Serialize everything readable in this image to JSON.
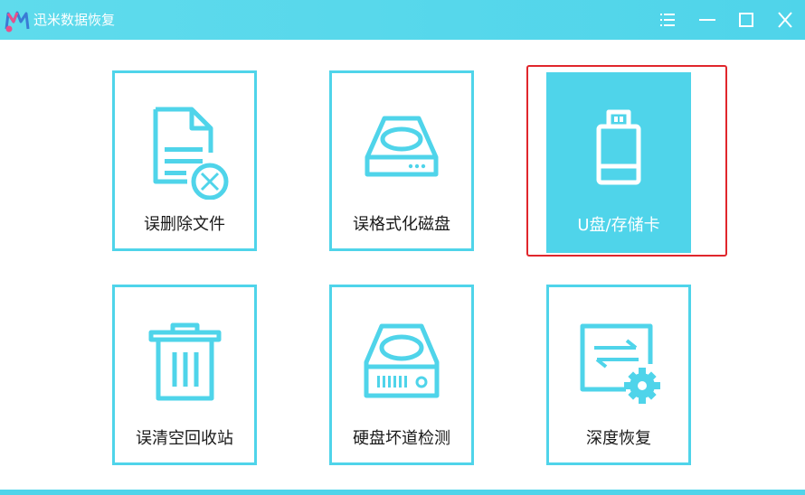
{
  "window": {
    "title": "迅米数据恢复",
    "accent_color": "#4fd4ea",
    "selection_color": "#e0262c",
    "controls": [
      {
        "name": "menu",
        "icon": "menu-lines-icon"
      },
      {
        "name": "minimize",
        "icon": "minimize-icon"
      },
      {
        "name": "maximize",
        "icon": "maximize-icon"
      },
      {
        "name": "close",
        "icon": "close-icon"
      }
    ]
  },
  "modes": [
    {
      "label": "误删除文件",
      "icon": "deleted-file-icon",
      "selected": false
    },
    {
      "label": "误格式化磁盘",
      "icon": "disk-drive-icon",
      "selected": false
    },
    {
      "label": "U盘/存储卡",
      "icon": "usb-drive-icon",
      "selected": true
    },
    {
      "label": "误清空回收站",
      "icon": "trash-bin-icon",
      "selected": false
    },
    {
      "label": "硬盘坏道检测",
      "icon": "hard-disk-icon",
      "selected": false
    },
    {
      "label": "深度恢复",
      "icon": "deep-recovery-icon",
      "selected": false
    }
  ]
}
